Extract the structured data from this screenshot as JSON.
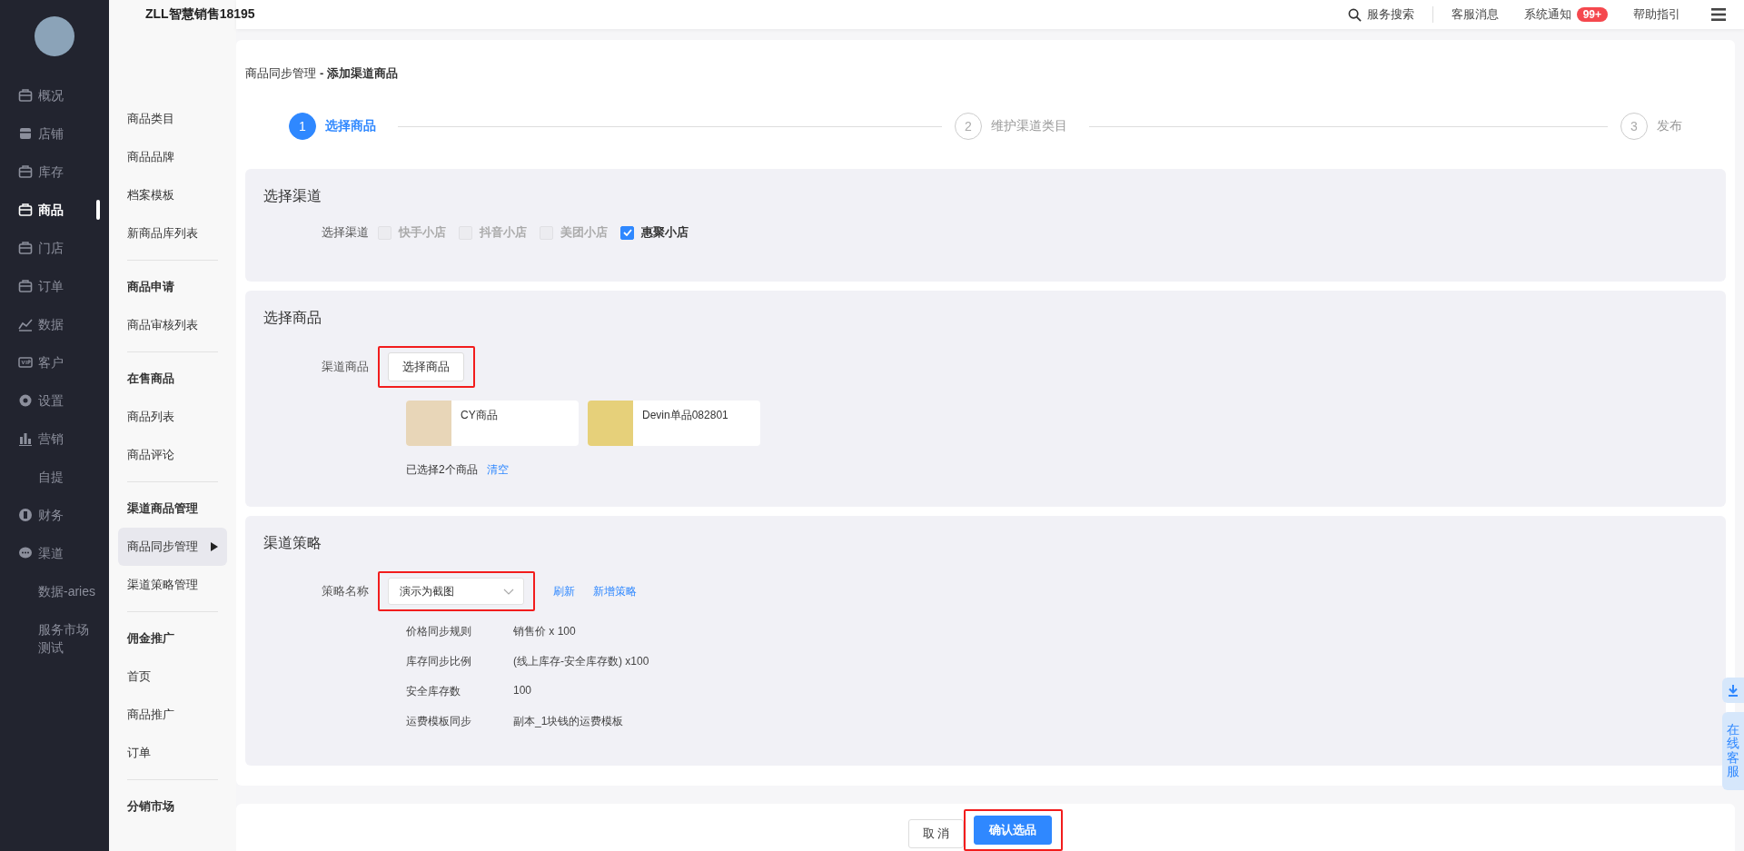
{
  "nav": {
    "items": [
      {
        "label": "概况",
        "kind": "icon",
        "selected": false
      },
      {
        "label": "店铺",
        "kind": "icon",
        "selected": false
      },
      {
        "label": "库存",
        "kind": "icon",
        "selected": false
      },
      {
        "label": "商品",
        "kind": "icon",
        "selected": true
      },
      {
        "label": "门店",
        "kind": "icon",
        "selected": false
      },
      {
        "label": "订单",
        "kind": "icon",
        "selected": false
      },
      {
        "label": "数据",
        "kind": "icon",
        "selected": false
      },
      {
        "label": "客户",
        "kind": "icon",
        "selected": false
      },
      {
        "label": "设置",
        "kind": "icon",
        "selected": false
      },
      {
        "label": "营销",
        "kind": "icon",
        "selected": false
      },
      {
        "label": "自提",
        "kind": "plain",
        "selected": false
      },
      {
        "label": "财务",
        "kind": "icon",
        "selected": false
      },
      {
        "label": "渠道",
        "kind": "icon",
        "selected": false
      },
      {
        "label": "数据-aries",
        "kind": "plain",
        "selected": false
      },
      {
        "label": "服务市场测试",
        "kind": "plain",
        "selected": false
      }
    ]
  },
  "submenu": {
    "groups": [
      {
        "items": [
          {
            "label": "商品类目",
            "selected": false
          },
          {
            "label": "商品品牌",
            "selected": false
          },
          {
            "label": "档案模板",
            "selected": false
          },
          {
            "label": "新商品库列表",
            "selected": false
          }
        ]
      },
      {
        "title": "商品申请",
        "items": [
          {
            "label": "商品审核列表",
            "selected": false
          }
        ]
      },
      {
        "title": "在售商品",
        "items": [
          {
            "label": "商品列表",
            "selected": false
          },
          {
            "label": "商品评论",
            "selected": false
          }
        ]
      },
      {
        "title": "渠道商品管理",
        "items": [
          {
            "label": "商品同步管理",
            "selected": true
          },
          {
            "label": "渠道策略管理",
            "selected": false
          }
        ]
      },
      {
        "title": "佣金推广",
        "items": [
          {
            "label": "首页",
            "selected": false
          },
          {
            "label": "商品推广",
            "selected": false
          },
          {
            "label": "订单",
            "selected": false
          }
        ]
      },
      {
        "title": "分销市场"
      }
    ]
  },
  "topbar": {
    "title": "ZLL智慧销售18195",
    "search": "服务搜索",
    "links": [
      {
        "label": "客服消息"
      },
      {
        "label": "系统通知",
        "badge": "99+"
      },
      {
        "label": "帮助指引"
      }
    ]
  },
  "page": {
    "breadcrumb": "商品同步管理",
    "title": "- 添加渠道商品",
    "steps": [
      {
        "number": "1",
        "label": "选择商品",
        "selected": true
      },
      {
        "number": "2",
        "label": "维护渠道类目",
        "selected": false
      },
      {
        "number": "3",
        "label": "发布",
        "selected": false
      }
    ]
  },
  "channel_section": {
    "title": "选择渠道",
    "label": "选择渠道",
    "options": [
      {
        "label": "快手小店",
        "checked": false,
        "disabled": true
      },
      {
        "label": "抖音小店",
        "checked": false,
        "disabled": true
      },
      {
        "label": "美团小店",
        "checked": false,
        "disabled": true
      },
      {
        "label": "惠聚小店",
        "checked": true,
        "disabled": false
      }
    ]
  },
  "product_section": {
    "title": "选择商品",
    "label": "渠道商品",
    "button": "选择商品",
    "highlighted": true,
    "products": [
      {
        "name": "CY商品"
      },
      {
        "name": "Devin单品082801"
      }
    ],
    "summary": "已选择2个商品",
    "clear": "清空"
  },
  "strategy_section": {
    "title": "渠道策略",
    "label": "策略名称",
    "value": "演示为截图",
    "highlighted": true,
    "refresh": "刷新",
    "add": "新增策略",
    "rows": [
      {
        "label": "价格同步规则",
        "value": "销售价 x 100"
      },
      {
        "label": "库存同步比例",
        "value": "(线上库存-安全库存数) x100"
      },
      {
        "label": "安全库存数",
        "value": "100"
      },
      {
        "label": "运费模板同步",
        "value": "副本_1块钱的运费模板"
      }
    ]
  },
  "footer": {
    "cancel": "取 消",
    "confirm": "确认选品",
    "highlighted": true
  },
  "float": {
    "service": "在线客服"
  }
}
